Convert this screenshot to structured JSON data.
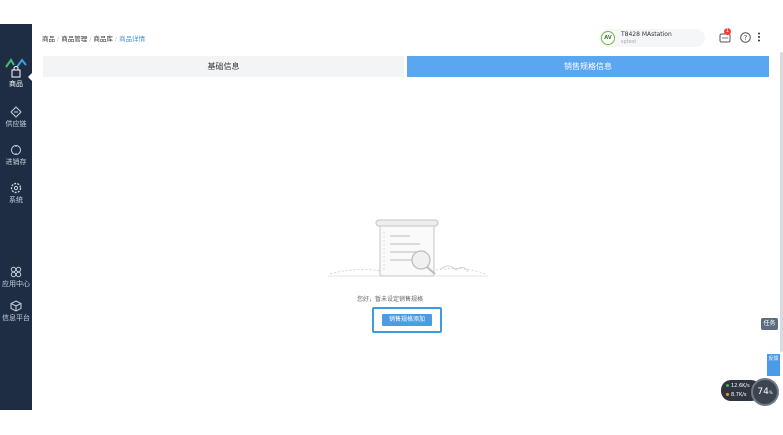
{
  "breadcrumb": {
    "items": [
      "商品",
      "商品管理",
      "商品库"
    ],
    "current": "商品详情"
  },
  "sidebar": {
    "items": [
      {
        "label": "商品",
        "icon": "shopping-bag-icon",
        "active": true
      },
      {
        "label": "供应链",
        "icon": "supply-chain-icon",
        "active": false
      },
      {
        "label": "进销存",
        "icon": "inventory-icon",
        "active": false
      },
      {
        "label": "系统",
        "icon": "gear-icon",
        "active": false
      },
      {
        "label": "应用中心",
        "icon": "apps-icon",
        "active": false
      },
      {
        "label": "信息平台",
        "icon": "cube-icon",
        "active": false
      }
    ]
  },
  "account": {
    "avatar_text": "AV",
    "name": "T8428 MAstation",
    "sub": "sptest"
  },
  "header": {
    "notification_count": "1"
  },
  "tabs": [
    {
      "label": "基础信息",
      "active": false
    },
    {
      "label": "销售规格信息",
      "active": true
    }
  ],
  "empty_state": {
    "message": "您好，暂未设定销售规格",
    "button_label": "销售规格添加"
  },
  "widgets": {
    "task_label": "任务",
    "side_flag_label": "反馈",
    "upload_speed": "12.6",
    "upload_unit": "K/s",
    "download_speed": "8.7",
    "download_unit": "K/s",
    "gauge_value": "74",
    "gauge_unit": "%"
  },
  "colors": {
    "sidebar_bg": "#1f2d44",
    "accent": "#5aa6f0",
    "button": "#4a9be8",
    "badge": "#f04134"
  }
}
